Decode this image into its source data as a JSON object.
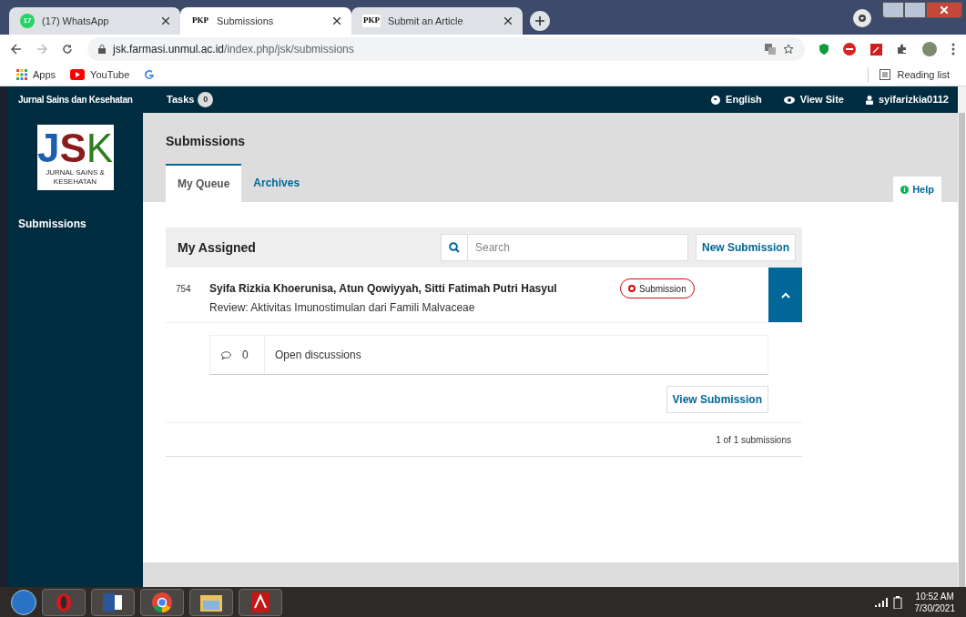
{
  "browser": {
    "tabs": [
      {
        "title": "(17) WhatsApp",
        "kind": "whatsapp",
        "badge": "17",
        "selected": false
      },
      {
        "title": "Submissions",
        "kind": "pkp",
        "badge": "PKP",
        "selected": true
      },
      {
        "title": "Submit an Article",
        "kind": "pkp",
        "badge": "PKP",
        "selected": false
      }
    ],
    "url_host": "jsk.farmasi.unmul.ac.id",
    "url_path": "/index.php/jsk/submissions",
    "bookmarks": [
      {
        "label": "Apps",
        "kind": "apps"
      },
      {
        "label": "YouTube",
        "kind": "youtube"
      },
      {
        "kind": "google"
      }
    ],
    "reading_list": "Reading list"
  },
  "app": {
    "site_name": "Jurnal Sains dan Kesehatan",
    "tasks_label": "Tasks",
    "tasks_count": "0",
    "header_links": [
      {
        "label": "English",
        "kind": "language"
      },
      {
        "label": "View Site",
        "kind": "site"
      },
      {
        "label": "syifarizkia0112",
        "kind": "user"
      }
    ],
    "logo": {
      "letter_1": "J",
      "letter_2": "S",
      "letter_3": "K",
      "caption_1": "JURNAL SAINS &",
      "caption_2": "KESEHATAN"
    },
    "sidebar": {
      "items": [
        {
          "label": "Submissions",
          "selected": true
        }
      ]
    },
    "page_title": "Submissions",
    "tabs": [
      {
        "label": "My Queue",
        "selected": true
      },
      {
        "label": "Archives",
        "selected": false
      }
    ],
    "help": "Help",
    "list": {
      "title": "My Assigned",
      "search_placeholder": "Search",
      "new_button": "New Submission",
      "items": [
        {
          "id": "754",
          "authors": "Syifa Rizkia Khoerunisa, Atun Qowiyyah, Sitti Fatimah Putri Hasyul",
          "title": "Review: Aktivitas Imunostimulan dari Famili Malvaceae",
          "stage": "Submission",
          "expanded": true,
          "discussions": "0",
          "discussions_label": "Open discussions",
          "view_button": "View Submission"
        }
      ],
      "count": "1 of 1 submissions"
    }
  },
  "taskbar": {
    "time": "10:52 AM",
    "date": "7/30/2021"
  }
}
